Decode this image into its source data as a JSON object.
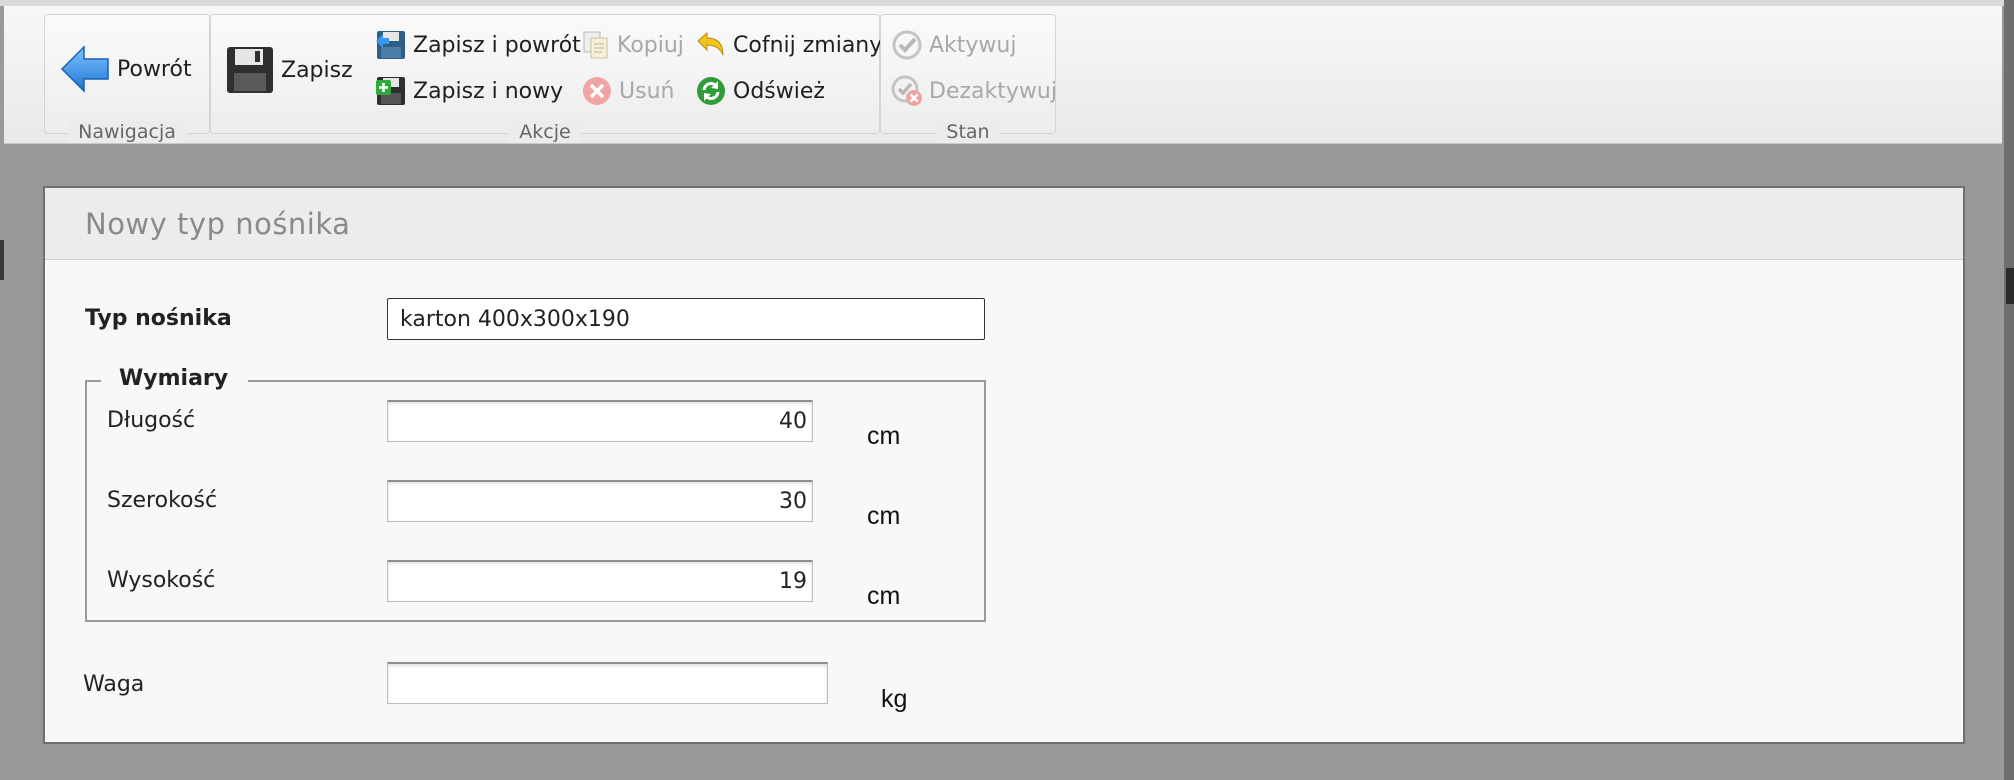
{
  "ribbon": {
    "groups": {
      "navigation": "Nawigacja",
      "actions": "Akcje",
      "state": "Stan"
    },
    "buttons": {
      "back": "Powrót",
      "save": "Zapisz",
      "save_and_back": "Zapisz i powrót",
      "save_and_new": "Zapisz i nowy",
      "copy": "Kopiuj",
      "delete": "Usuń",
      "undo_changes": "Cofnij zmiany",
      "refresh": "Odśwież",
      "activate": "Aktywuj",
      "deactivate": "Dezaktywuj"
    }
  },
  "form": {
    "title": "Nowy typ nośnika",
    "carrier_type": {
      "label": "Typ nośnika",
      "value": "karton 400x300x190"
    },
    "dimensions": {
      "legend": "Wymiary",
      "length": {
        "label": "Długość",
        "value": "40",
        "unit": "cm"
      },
      "width": {
        "label": "Szerokość",
        "value": "30",
        "unit": "cm"
      },
      "height": {
        "label": "Wysokość",
        "value": "19",
        "unit": "cm"
      }
    },
    "weight": {
      "label": "Waga",
      "value": "",
      "unit": "kg"
    }
  },
  "colors": {
    "overlay": "#999999",
    "panel": "#f8f8f8",
    "header": "#ececec",
    "disabled_text": "#a8a8a8"
  }
}
